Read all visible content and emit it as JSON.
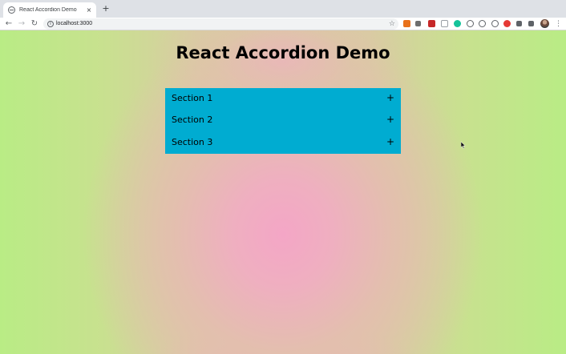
{
  "browser": {
    "tab_title": "React Accordion Demo",
    "tab_close": "×",
    "new_tab": "+",
    "url": "localhost:3000",
    "back": "←",
    "forward": "→",
    "reload": "↻",
    "star": "☆",
    "menu": "⋮",
    "extensions": [
      {
        "name": "ext-orange-icon",
        "color": "#e8711a"
      },
      {
        "name": "ext-hand-icon",
        "color": "#6e6e6e"
      },
      {
        "name": "ext-red-square-icon",
        "color": "#c62828"
      },
      {
        "name": "ext-gray-icon",
        "color": "#9aa0a6"
      },
      {
        "name": "ext-green-circle-icon",
        "color": "#15c39a"
      },
      {
        "name": "ext-circle-icon",
        "color": "#5f6368"
      },
      {
        "name": "ext-check-icon",
        "color": "#5f6368"
      },
      {
        "name": "ext-shield-icon",
        "color": "#5f6368"
      },
      {
        "name": "ext-red-icon",
        "color": "#e53935"
      },
      {
        "name": "puzzle-icon",
        "color": "#5f6368"
      },
      {
        "name": "reading-list-icon",
        "color": "#5f6368"
      }
    ]
  },
  "page": {
    "title": "React Accordion Demo",
    "accent": "#00acd1",
    "sections": [
      {
        "label": "Section 1",
        "icon": "+"
      },
      {
        "label": "Section 2",
        "icon": "+"
      },
      {
        "label": "Section 3",
        "icon": "+"
      }
    ]
  }
}
